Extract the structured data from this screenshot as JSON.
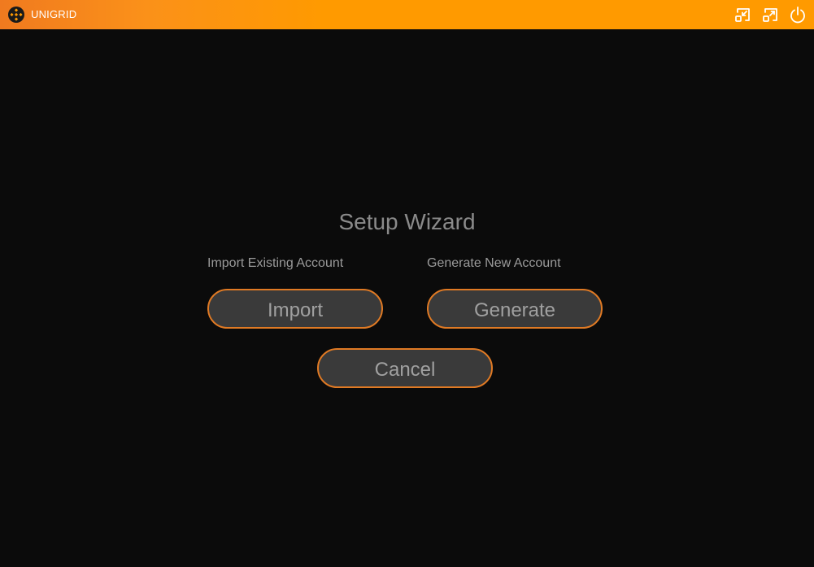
{
  "titlebar": {
    "app_name": "UNIGRID",
    "logo_icon": "unigrid-logo-icon",
    "buttons": {
      "minimize_icon": "shrink-icon",
      "maximize_icon": "expand-icon",
      "power_icon": "power-icon"
    },
    "background_color": "#ff9a00"
  },
  "wizard": {
    "title": "Setup Wizard",
    "import_label": "Import Existing Account",
    "generate_label": "Generate New Account",
    "import_button": "Import",
    "generate_button": "Generate",
    "cancel_button": "Cancel"
  },
  "colors": {
    "accent": "#e07a24",
    "background": "#0b0b0b",
    "button_fill": "#3a3a3a",
    "text_muted": "#9a9a9a"
  }
}
